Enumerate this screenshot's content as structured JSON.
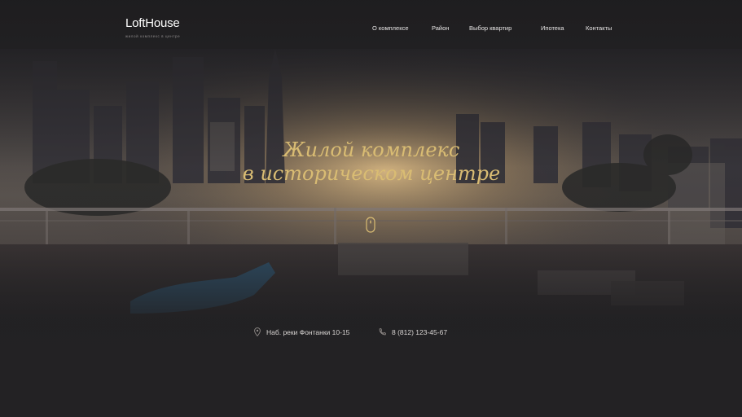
{
  "brand": {
    "logo": "LoftHouse",
    "tagline": "жилой комплекс в центре"
  },
  "nav": {
    "items": [
      {
        "label": "О комплексе"
      },
      {
        "label": "Район"
      },
      {
        "label": "Выбор квартир"
      },
      {
        "label": "Ипотека"
      },
      {
        "label": "Контакты"
      }
    ]
  },
  "hero": {
    "title_line1": "Жилой комплекс",
    "title_line2": "в историческом центре"
  },
  "contacts": {
    "address": "Наб. реки Фонтанки 10-15",
    "phone": "8 (812) 123-45-67"
  },
  "colors": {
    "accent_gold": "#d9bc73",
    "background": "#242325",
    "text": "#e8e6e6"
  },
  "icons": {
    "scroll": "mouse-scroll-icon",
    "address": "location-pin-icon",
    "phone": "phone-icon"
  }
}
